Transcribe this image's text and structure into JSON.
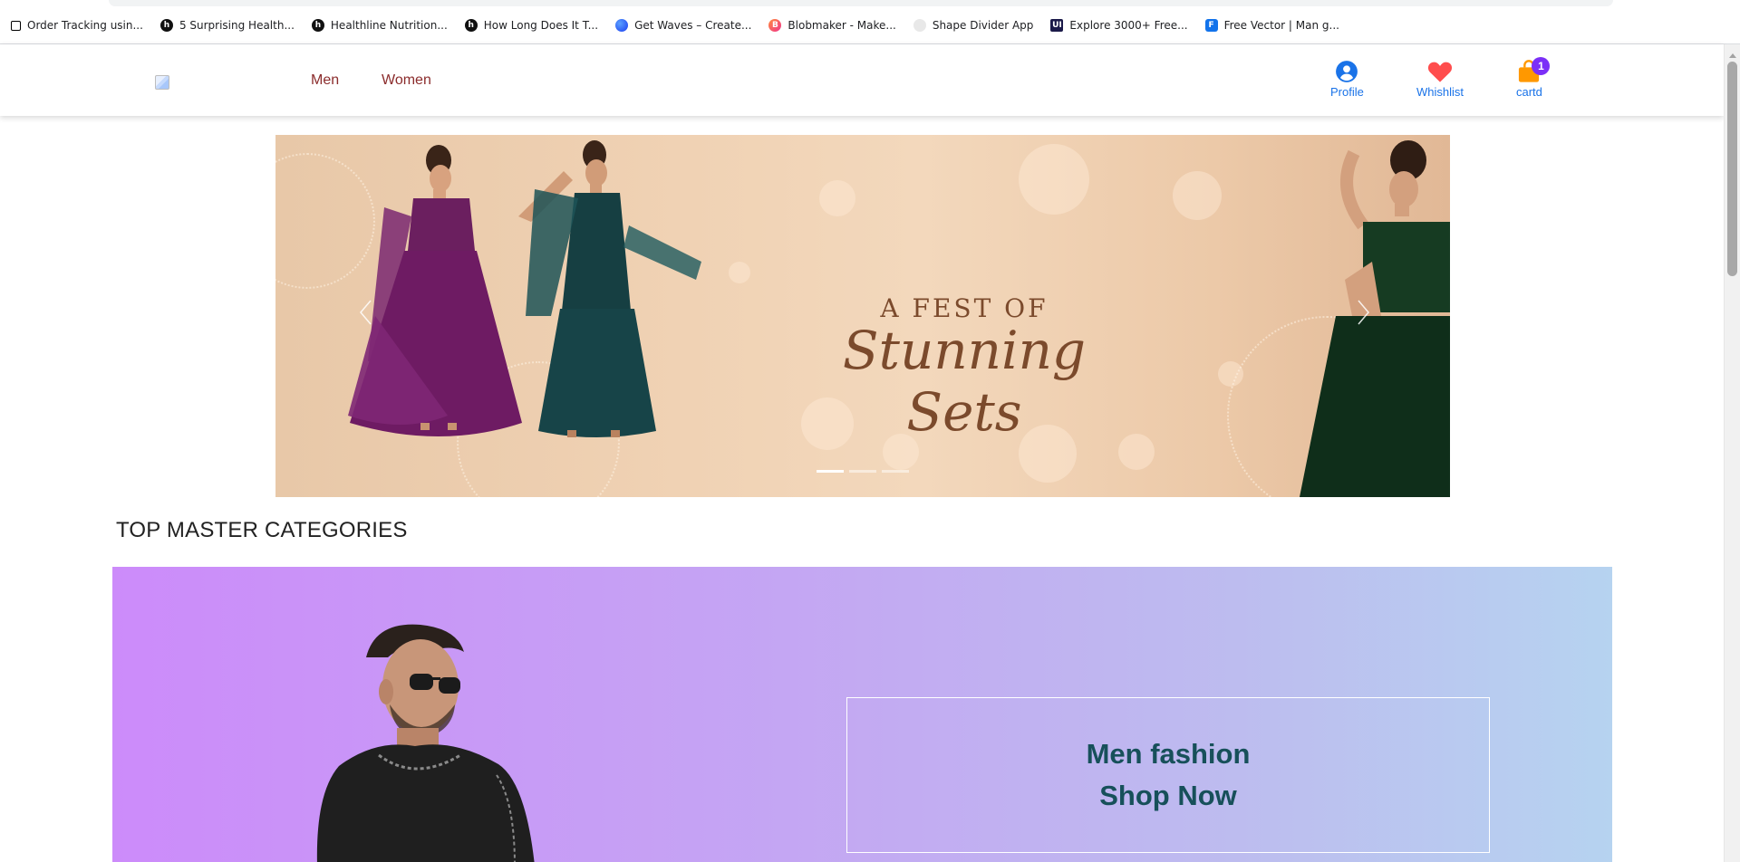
{
  "bookmarks": [
    {
      "label": "Order Tracking usin...",
      "icon": "codepen-icon",
      "color": "#000000"
    },
    {
      "label": "5 Surprising Health...",
      "icon": "healthline-icon",
      "color": "#111111"
    },
    {
      "label": "Healthline Nutrition...",
      "icon": "healthline-icon",
      "color": "#111111"
    },
    {
      "label": "How Long Does It T...",
      "icon": "healthline-icon",
      "color": "#111111"
    },
    {
      "label": "Get Waves – Create...",
      "icon": "waves-icon",
      "color": "#1a3cf0"
    },
    {
      "label": "Blobmaker - Make...",
      "icon": "blobmaker-icon",
      "color": "#f0358b"
    },
    {
      "label": "Shape Divider App",
      "icon": "shapedivider-icon",
      "color": "#cfcfcf"
    },
    {
      "label": "Explore 3000+ Free...",
      "icon": "uiverse-icon",
      "color": "#1b1a4a"
    },
    {
      "label": "Free Vector | Man g...",
      "icon": "freepik-icon",
      "color": "#1273eb"
    }
  ],
  "header": {
    "nav": [
      "Men",
      "Women"
    ],
    "profile_label": "Profile",
    "wishlist_label": "Whishlist",
    "cart_label": "cartd",
    "cart_count": "1"
  },
  "banner": {
    "line1": "A FEST OF",
    "line2": "Stunning Sets",
    "slides": 3,
    "active_slide": 1
  },
  "section": {
    "title": "TOP MASTER CATEGORIES"
  },
  "category_card": {
    "title": "Men fashion",
    "cta": "Shop Now"
  },
  "colors": {
    "nav_link": "#8b2c2c",
    "header_link": "#1a73e8",
    "badge": "#7b2ff7",
    "cta_text": "#17505a"
  }
}
